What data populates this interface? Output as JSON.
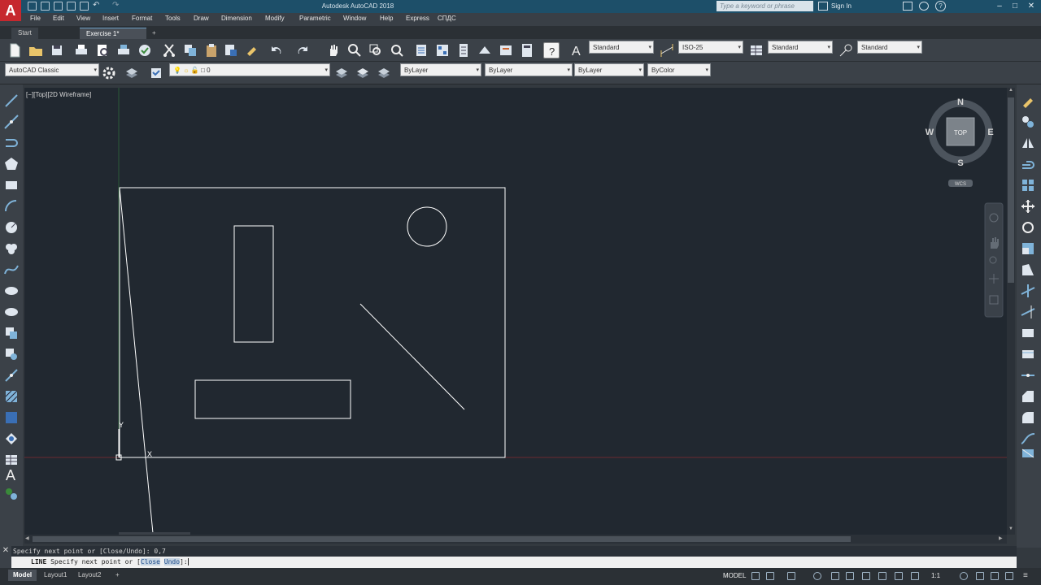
{
  "app": {
    "logo": "A",
    "title": "Autodesk AutoCAD 2018",
    "search_placeholder": "Type a keyword or phrase",
    "sign_in": "Sign In"
  },
  "menu": [
    "File",
    "Edit",
    "View",
    "Insert",
    "Format",
    "Tools",
    "Draw",
    "Dimension",
    "Modify",
    "Parametric",
    "Window",
    "Help",
    "Express",
    "СПДС"
  ],
  "file_tabs": {
    "start": "Start",
    "active": "Exercise 1*",
    "add": "+"
  },
  "styles": {
    "text_style": "Standard",
    "dim_style": "ISO-25",
    "table_style": "Standard",
    "mleader_style": "Standard"
  },
  "workspace": "AutoCAD Classic",
  "layer": "0",
  "properties": {
    "color": "ByLayer",
    "linetype": "ByLayer",
    "lineweight": "ByLayer",
    "plotstyle": "ByColor"
  },
  "viewport": {
    "label": "[−][Top][2D Wireframe]",
    "ucs_y": "Y",
    "ucs_x": "X"
  },
  "viewcube": {
    "n": "N",
    "s": "S",
    "e": "E",
    "w": "W",
    "face": "TOP",
    "wcs": "WCS"
  },
  "command": {
    "history": "Specify next point or [Close/Undo]: 0,7",
    "prompt_cmd": "LINE",
    "prompt_text": "Specify next point or [",
    "option_close": "Close",
    "separator": " ",
    "option_undo": "Undo",
    "prompt_end": "]: "
  },
  "layout_tabs": [
    "Model",
    "Layout1",
    "Layout2"
  ],
  "status": {
    "model": "MODEL",
    "scale": "1:1"
  },
  "colors": {
    "title_bar": "#1d4f69",
    "canvas": "#212830",
    "ui_bg": "#3b4148",
    "axis_y": "#3f9a45",
    "axis_x": "#9b2d2d"
  }
}
